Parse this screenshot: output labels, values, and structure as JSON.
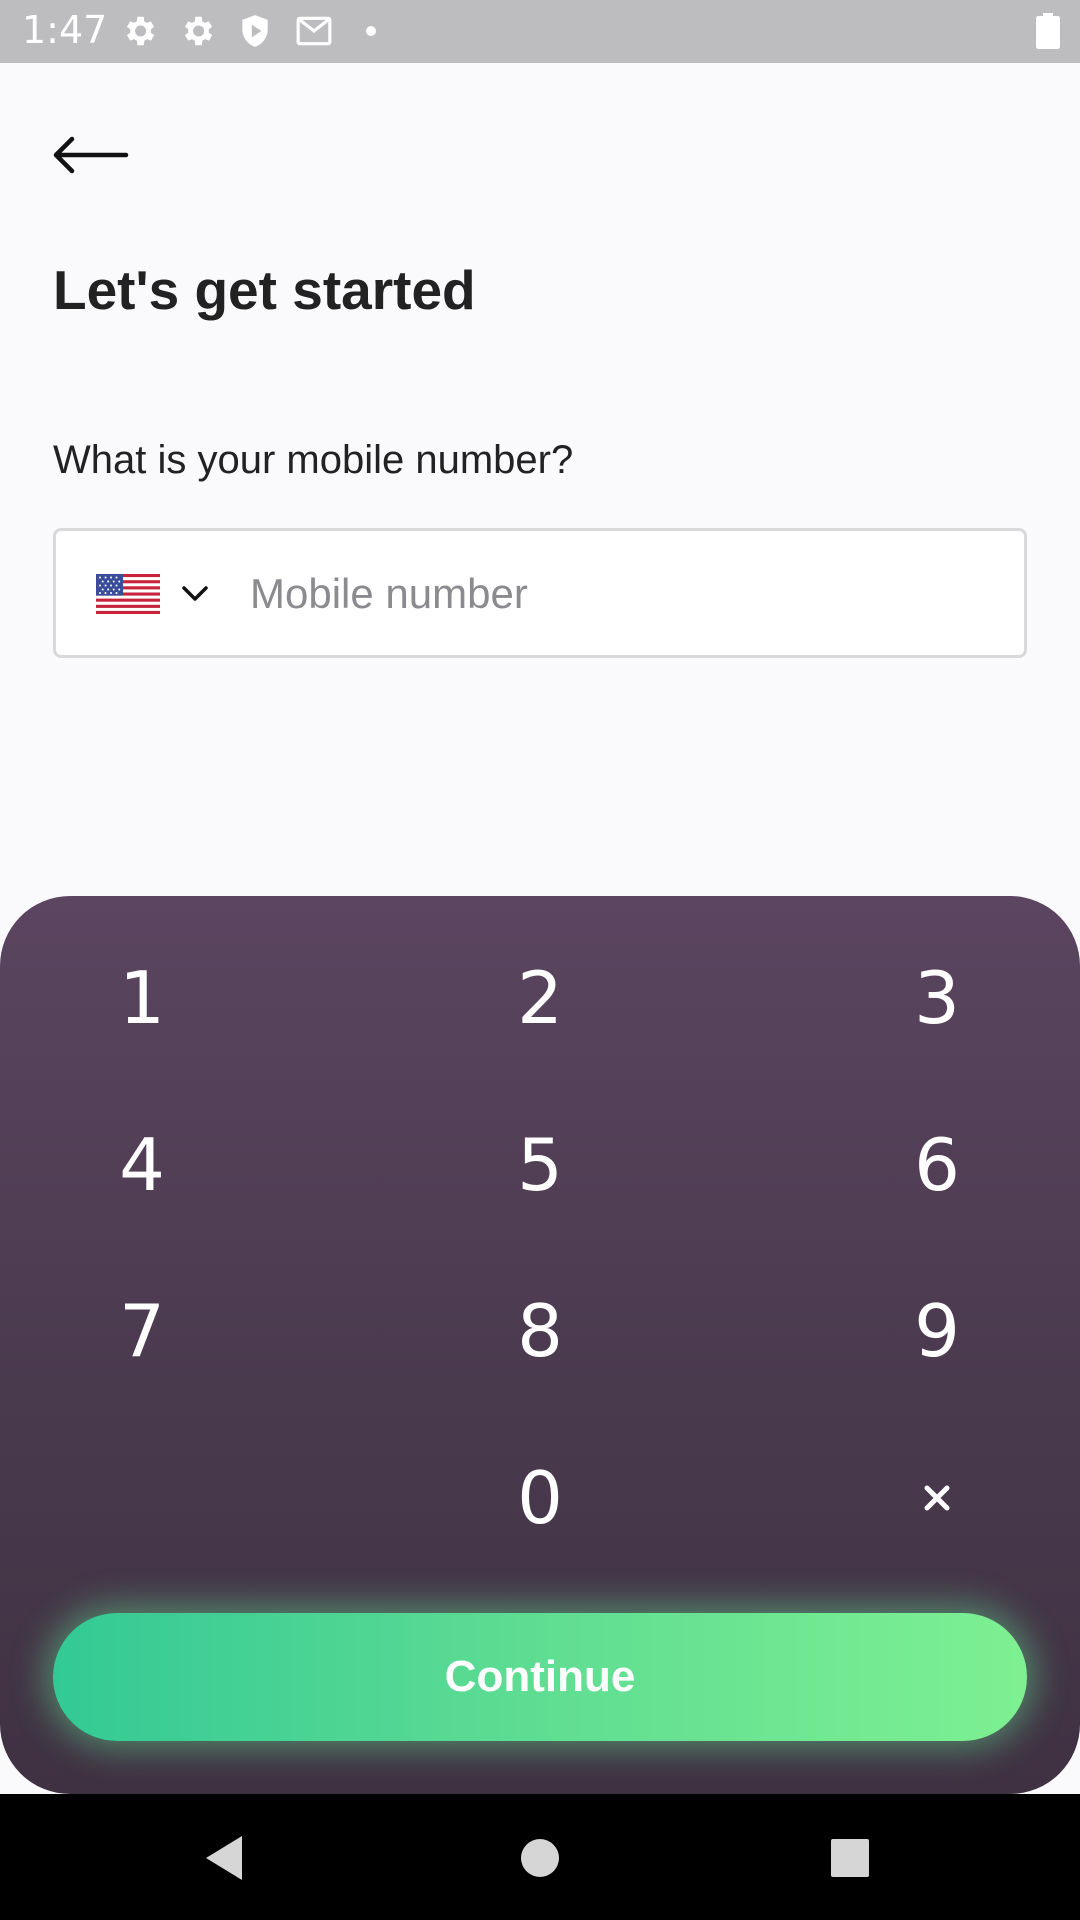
{
  "status_bar": {
    "time": "1:47",
    "icons": [
      "settings-gear-icon",
      "settings-gear-icon",
      "shield-play-icon",
      "gmail-icon",
      "notification-dot-icon",
      "battery-icon"
    ]
  },
  "header": {
    "back_icon": "arrow-left-icon",
    "title": "Let's get started"
  },
  "form": {
    "question": "What is your mobile number?",
    "country": {
      "flag": "us-flag-icon",
      "dropdown_icon": "chevron-down-icon"
    },
    "mobile_placeholder": "Mobile number",
    "mobile_value": ""
  },
  "keypad": {
    "keys": [
      "1",
      "2",
      "3",
      "4",
      "5",
      "6",
      "7",
      "8",
      "9",
      "0"
    ],
    "delete_icon": "close-x-icon"
  },
  "continue_label": "Continue",
  "nav_bar": {
    "icons": [
      "back-triangle-icon",
      "home-circle-icon",
      "recents-square-icon"
    ]
  },
  "colors": {
    "keypad_top": "#5b4560",
    "keypad_bottom": "#3f3142",
    "button_start": "#33c995",
    "button_end": "#7ef092",
    "status_bar": "#bdbdbf",
    "background": "#fafafd"
  }
}
